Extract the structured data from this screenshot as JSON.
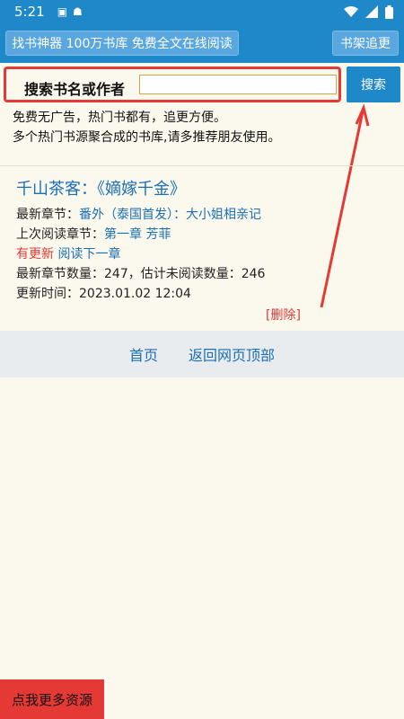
{
  "status_bar": {
    "time": "5:21",
    "icons": [
      "a-notification-icon",
      "android-notification-icon",
      "wifi-icon",
      "signal-icon",
      "battery-icon"
    ]
  },
  "top_bar": {
    "promo_button": "找书神器 100万书库 免费全文在线阅读",
    "shelf_button": "书架追更"
  },
  "search": {
    "label": "搜索书名或作者",
    "value": "",
    "button": "搜索"
  },
  "intro": {
    "line1": "免费无广告，热门书都有，追更方便。",
    "line2": "多个热门书源聚合成的书库,请多推荐朋友使用。"
  },
  "book": {
    "title": "千山茶客：《嫡嫁千金》",
    "latest_label": "最新章节：",
    "latest_value": "番外（泰国首发）：大小姐相亲记",
    "last_read_label": "上次阅读章节：",
    "last_read_value": "第一章 芳菲",
    "has_update": "有更新",
    "read_next": "阅读下一章",
    "counts": "最新章节数量：247，估计未阅读数量：246",
    "updated": "更新时间：2023.01.02 12:04",
    "delete": "[删除]"
  },
  "footer": {
    "home": "首页",
    "back_top": "返回网页顶部"
  },
  "ad_button": "点我更多资源",
  "colors": {
    "primary": "#1e88c9",
    "link": "#1a6fb5",
    "accent_red": "#e53935",
    "background": "#fbf8ee"
  }
}
